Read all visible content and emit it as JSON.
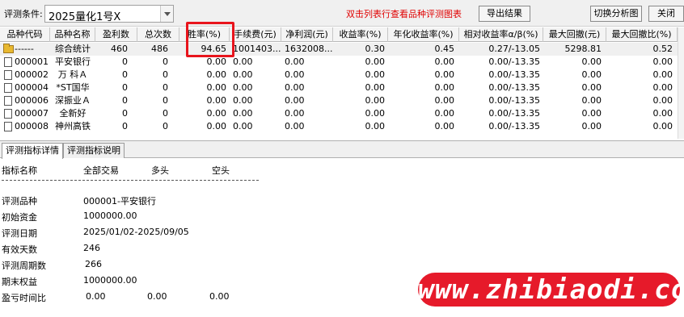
{
  "toolbar": {
    "condition_label": "评测条件:",
    "condition_value": "2025量化1号X",
    "hint": "双击列表行查看品种评测图表",
    "export_label": "导出结果",
    "switch_label": "切换分析图",
    "close_label": "关闭"
  },
  "table": {
    "columns": [
      "品种代码",
      "品种名称",
      "盈利数",
      "总次数",
      "胜率(%)",
      "手续费(元)",
      "净利润(元)",
      "收益率(%)",
      "年化收益率(%)",
      "相对收益率α/β(%)",
      "最大回撤(元)",
      "最大回撤比(%)"
    ],
    "rows": [
      {
        "code": "------",
        "name": "综合统计",
        "profit": "460",
        "total": "486",
        "win": "94.65",
        "fee": "1001403...",
        "net": "1632008...",
        "ret": "0.30",
        "annual": "0.45",
        "rel": "0.27/-13.05",
        "dd": "5298.81",
        "ddr": "0.52",
        "icon": "folder-icon"
      },
      {
        "code": "000001",
        "name": "平安银行",
        "profit": "0",
        "total": "0",
        "win": "0.00",
        "fee": "0.00",
        "net": "0.00",
        "ret": "0.00",
        "annual": "0.00",
        "rel": "0.00/-13.35",
        "dd": "0.00",
        "ddr": "0.00",
        "icon": "document-icon"
      },
      {
        "code": "000002",
        "name": "万 科Ａ",
        "profit": "0",
        "total": "0",
        "win": "0.00",
        "fee": "0.00",
        "net": "0.00",
        "ret": "0.00",
        "annual": "0.00",
        "rel": "0.00/-13.35",
        "dd": "0.00",
        "ddr": "0.00",
        "icon": "document-icon"
      },
      {
        "code": "000004",
        "name": "*ST国华",
        "profit": "0",
        "total": "0",
        "win": "0.00",
        "fee": "0.00",
        "net": "0.00",
        "ret": "0.00",
        "annual": "0.00",
        "rel": "0.00/-13.35",
        "dd": "0.00",
        "ddr": "0.00",
        "icon": "document-icon"
      },
      {
        "code": "000006",
        "name": "深振业Ａ",
        "profit": "0",
        "total": "0",
        "win": "0.00",
        "fee": "0.00",
        "net": "0.00",
        "ret": "0.00",
        "annual": "0.00",
        "rel": "0.00/-13.35",
        "dd": "0.00",
        "ddr": "0.00",
        "icon": "document-icon"
      },
      {
        "code": "000007",
        "name": "全新好",
        "profit": "0",
        "total": "0",
        "win": "0.00",
        "fee": "0.00",
        "net": "0.00",
        "ret": "0.00",
        "annual": "0.00",
        "rel": "0.00/-13.35",
        "dd": "0.00",
        "ddr": "0.00",
        "icon": "document-icon"
      },
      {
        "code": "000008",
        "name": "神州高铁",
        "profit": "0",
        "total": "0",
        "win": "0.00",
        "fee": "0.00",
        "net": "0.00",
        "ret": "0.00",
        "annual": "0.00",
        "rel": "0.00/-13.35",
        "dd": "0.00",
        "ddr": "0.00",
        "icon": "document-icon"
      }
    ]
  },
  "tabs": {
    "detail": "评测指标详情",
    "explain": "评测指标说明"
  },
  "detail": {
    "header": {
      "name": "指标名称",
      "all": "全部交易",
      "long": "多头",
      "short": "空头"
    },
    "items": [
      {
        "label": "评测品种",
        "value": "000001-平安银行"
      },
      {
        "label": "初始资金",
        "value": "1000000.00"
      },
      {
        "label": "评测日期",
        "value": "2025/01/02-2025/09/05"
      },
      {
        "label": "有效天数",
        "value": "246"
      },
      {
        "label": "评测周期数",
        "value": "266"
      },
      {
        "label": "期末权益",
        "value": "1000000.00"
      }
    ],
    "ratio": {
      "label": "盈亏时间比",
      "all": "0.00",
      "long": "0.00",
      "short": "0.00"
    }
  },
  "watermark": "www.zhibiaodi.com"
}
